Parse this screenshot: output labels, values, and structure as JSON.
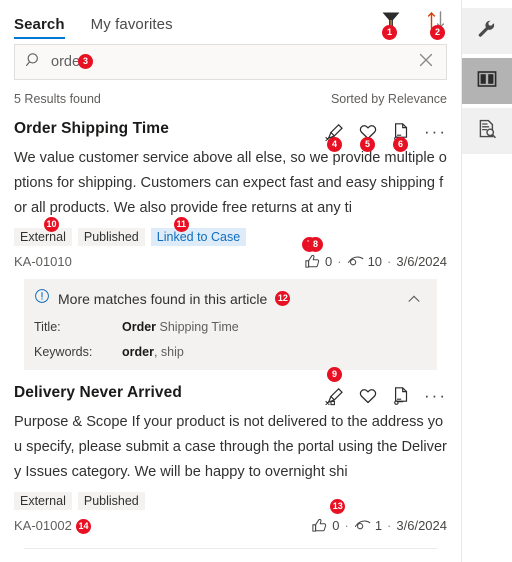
{
  "tabs": [
    {
      "label": "Search",
      "active": true
    },
    {
      "label": "My favorites",
      "active": false
    }
  ],
  "header_icons": [
    {
      "name": "filter-icon",
      "badge": "1"
    },
    {
      "name": "sort-icon",
      "badge": "2"
    }
  ],
  "search": {
    "value": "order",
    "placeholder": "Search",
    "badge": "3",
    "clear_label": "Clear search"
  },
  "results": {
    "count_text": "5 Results found",
    "sort_text": "Sorted by Relevance"
  },
  "articles": [
    {
      "title": "Order Shipping Time",
      "body": "We value customer service above all else, so we provide multiple options for shipping. Customers can expect fast and easy shipping for all products. We also provide free returns at any ti",
      "actions": [
        {
          "name": "link-article-icon",
          "badge": "4"
        },
        {
          "name": "favorite-heart-icon",
          "badge": "5"
        },
        {
          "name": "copy-link-icon",
          "badge": "6"
        },
        {
          "name": "more-options-icon",
          "badge": ""
        }
      ],
      "tags": [
        {
          "label": "External",
          "style": "gray",
          "badge": "10"
        },
        {
          "label": "Published",
          "style": "gray",
          "badge": ""
        },
        {
          "label": "Linked to Case",
          "style": "blue",
          "badge": "11"
        }
      ],
      "ka_id": "KA-01010",
      "ka_badge": "",
      "likes": "0",
      "likes_badge": "7",
      "views": "10",
      "views_badge": "8",
      "date": "3/6/2024",
      "date_badge": "",
      "matches": {
        "title": "More matches found in this article",
        "badge": "12",
        "rows": [
          {
            "label": "Title:",
            "highlight": "Order",
            "rest": " Shipping Time"
          },
          {
            "label": "Keywords:",
            "highlight": "order",
            "rest": ", ship"
          }
        ]
      }
    },
    {
      "title": "Delivery Never Arrived",
      "body": "Purpose & Scope If your product is not delivered to the address you specify, please submit a case through the portal using the Delivery Issues category. We will be happy to overnight shi",
      "actions": [
        {
          "name": "link-article-icon",
          "badge": "9"
        },
        {
          "name": "favorite-heart-icon",
          "badge": ""
        },
        {
          "name": "copy-link-icon",
          "badge": ""
        },
        {
          "name": "more-options-icon",
          "badge": ""
        }
      ],
      "tags": [
        {
          "label": "External",
          "style": "gray",
          "badge": ""
        },
        {
          "label": "Published",
          "style": "gray",
          "badge": ""
        }
      ],
      "ka_id": "KA-01002",
      "ka_badge": "14",
      "likes": "0",
      "likes_badge": "",
      "views": "1",
      "views_badge": "",
      "date": "3/6/2024",
      "date_badge": "13",
      "matches": null
    }
  ],
  "rail": [
    {
      "name": "tools-wrench-icon",
      "active": false
    },
    {
      "name": "knowledge-book-icon",
      "active": true
    },
    {
      "name": "document-search-icon",
      "active": false
    }
  ],
  "colors": {
    "accent": "#0078d4",
    "badge": "#e81123",
    "tag_blue_bg": "#deecf9",
    "tag_blue_text": "#0f6cbd",
    "panel_bg": "#f3f2f1"
  }
}
